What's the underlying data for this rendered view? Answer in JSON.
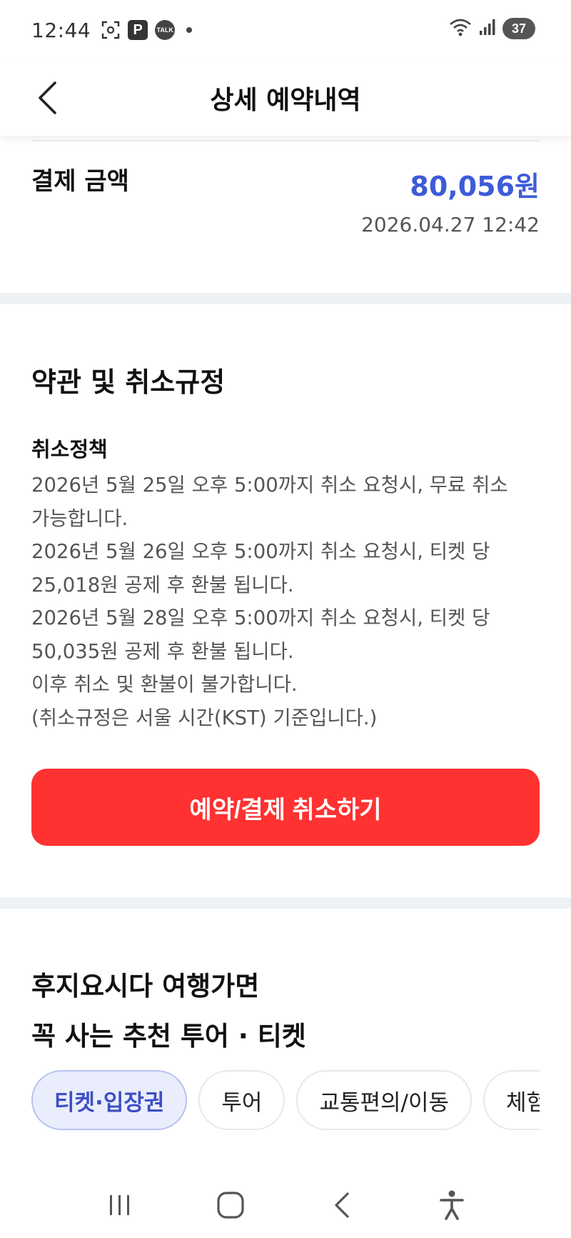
{
  "status_bar": {
    "time": "12:44",
    "battery": "37",
    "icons": [
      "screenshot-icon",
      "parking-icon",
      "kakaotalk-icon",
      "notification-dot",
      "wifi-icon",
      "signal-icon",
      "battery-icon"
    ],
    "p_label": "P",
    "talk_label": "TALK"
  },
  "header": {
    "title": "상세 예약내역",
    "back_icon": "chevron-left-icon"
  },
  "payment": {
    "label": "결제 금액",
    "amount": "80,056원",
    "date": "2026.04.27 12:42",
    "amount_color": "#3d5bd9"
  },
  "terms": {
    "title": "약관 및 취소규정",
    "policy_subtitle": "취소정책",
    "lines": [
      "2026년 5월 25일 오후 5:00까지 취소 요청시, 무료 취소",
      "가능합니다.",
      "2026년 5월 26일 오후 5:00까지 취소 요청시, 티켓 당",
      "25,018원 공제 후 환불 됩니다.",
      "2026년 5월 28일 오후 5:00까지 취소 요청시, 티켓 당",
      "50,035원 공제 후 환불 됩니다.",
      "이후 취소 및 환불이 불가합니다.",
      "(취소규정은 서울 시간(KST) 기준입니다.)"
    ],
    "cancel_button": "예약/결제 취소하기",
    "cancel_color": "#ff3131"
  },
  "recommend": {
    "title_line1": "후지요시다 여행가면",
    "title_line2": "꼭 사는 추천 투어 · 티켓",
    "chips": [
      "티켓·입장권",
      "투어",
      "교통편의/이동",
      "체험"
    ],
    "active_chip": "티켓·입장권"
  },
  "nav": {
    "icons": [
      "recent-apps-icon",
      "home-icon",
      "back-icon",
      "accessibility-icon"
    ]
  }
}
